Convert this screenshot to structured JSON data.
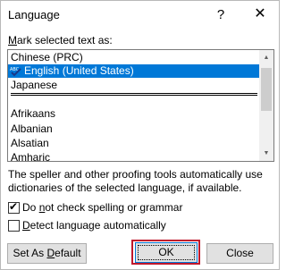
{
  "dialog": {
    "title": "Language",
    "help_icon": "question-mark-icon",
    "close_icon": "close-icon"
  },
  "list": {
    "label_accel": "M",
    "label_rest": "ark selected text as:",
    "items": [
      {
        "label": "Chinese (PRC)",
        "selected": false
      },
      {
        "label": "English (United States)",
        "selected": true,
        "icon": "spellcheck-abc-icon"
      },
      {
        "label": "Japanese",
        "selected": false
      },
      {
        "label": "Afrikaans",
        "selected": false
      },
      {
        "label": "Albanian",
        "selected": false
      },
      {
        "label": "Alsatian",
        "selected": false
      },
      {
        "label": "Amharic",
        "selected": false
      }
    ]
  },
  "description": "The speller and other proofing tools automatically use dictionaries of the selected language, if available.",
  "checkboxes": {
    "no_spell": {
      "prefix": "Do ",
      "accel": "n",
      "suffix": "ot check spelling or grammar",
      "checked": true
    },
    "detect": {
      "prefix": "",
      "accel": "D",
      "suffix": "etect language automatically",
      "checked": false
    }
  },
  "buttons": {
    "default_prefix": "Set As ",
    "default_accel": "D",
    "default_suffix": "efault",
    "ok": "OK",
    "close": "Close"
  },
  "colors": {
    "selection": "#0078d7",
    "highlight_border": "#c0182c"
  }
}
